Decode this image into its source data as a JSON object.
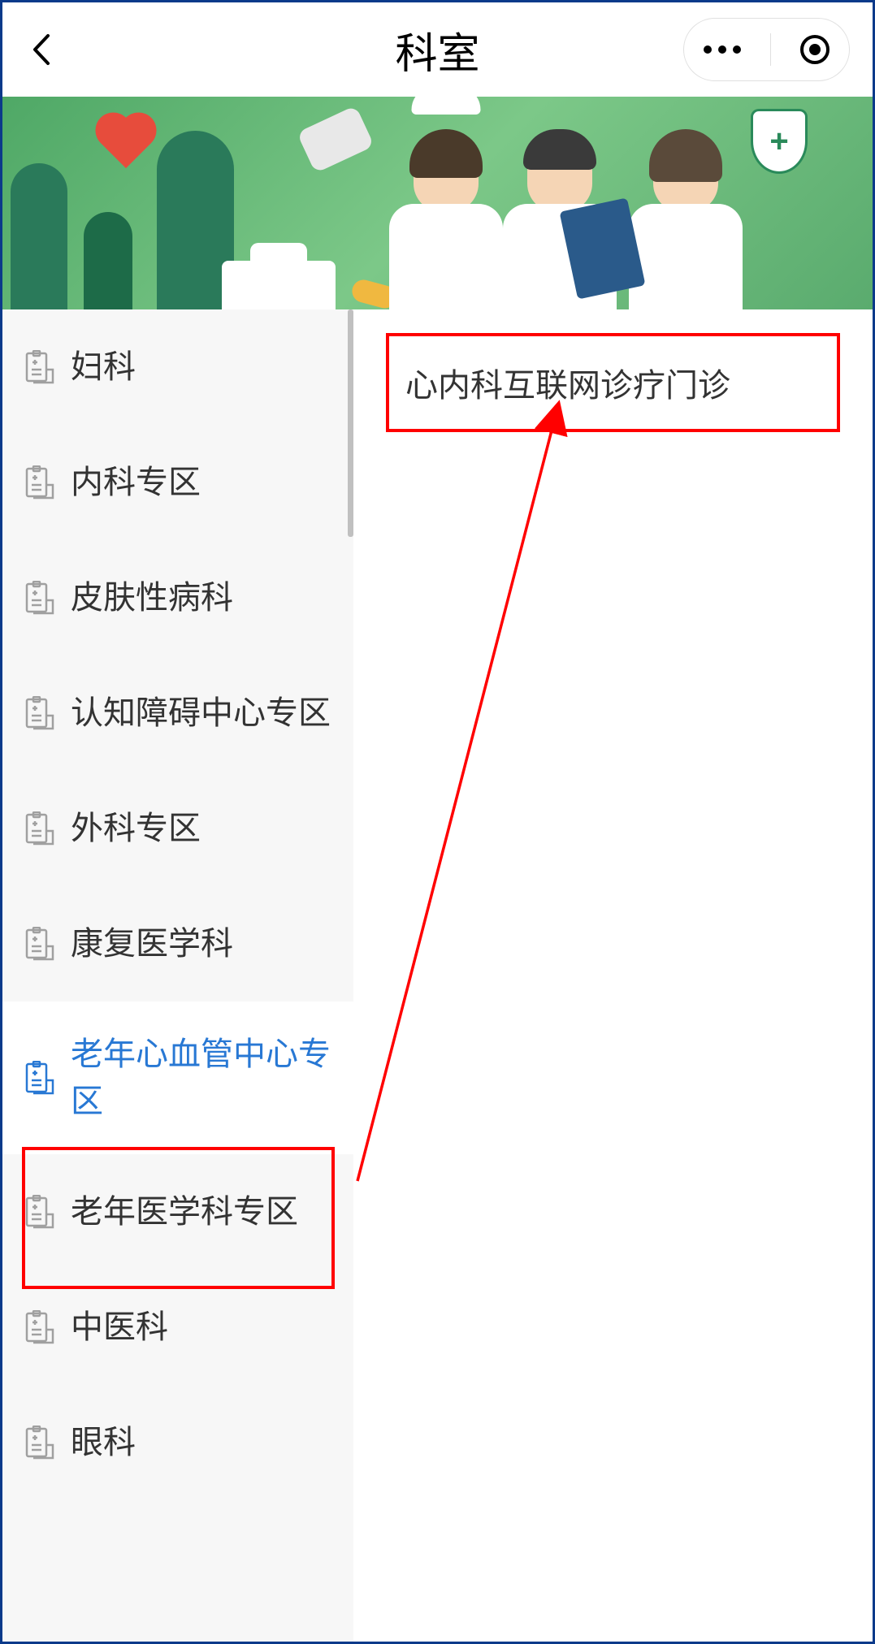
{
  "header": {
    "title": "科室"
  },
  "sidebar": {
    "items": [
      {
        "label": "妇科",
        "active": false
      },
      {
        "label": "内科专区",
        "active": false
      },
      {
        "label": "皮肤性病科",
        "active": false
      },
      {
        "label": "认知障碍中心专区",
        "active": false
      },
      {
        "label": "外科专区",
        "active": false
      },
      {
        "label": "康复医学科",
        "active": false
      },
      {
        "label": "老年心血管中心专区",
        "active": true
      },
      {
        "label": "老年医学科专区",
        "active": false
      },
      {
        "label": "中医科",
        "active": false
      },
      {
        "label": "眼科",
        "active": false
      }
    ]
  },
  "content": {
    "item": "心内科互联网诊疗门诊"
  }
}
